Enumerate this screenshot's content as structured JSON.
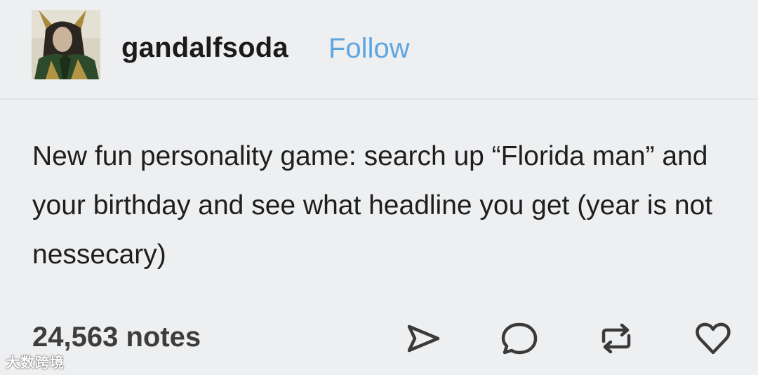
{
  "post": {
    "username": "gandalfsoda",
    "follow_label": "Follow",
    "body": "New fun personality game: search up “Florida man” and your birthday and see what headline you get (year is not nessecary)",
    "notes": "24,563 notes"
  },
  "actions": {
    "share_icon": "send-icon",
    "reply_icon": "reply-bubble-icon",
    "reblog_icon": "reblog-icon",
    "like_icon": "heart-icon"
  },
  "watermark": {
    "text": "大数跨境"
  },
  "colors": {
    "background": "#eeeff1",
    "follow": "#5fa6e0",
    "text": "#1e1e1e",
    "icon": "#3a3a3a"
  }
}
